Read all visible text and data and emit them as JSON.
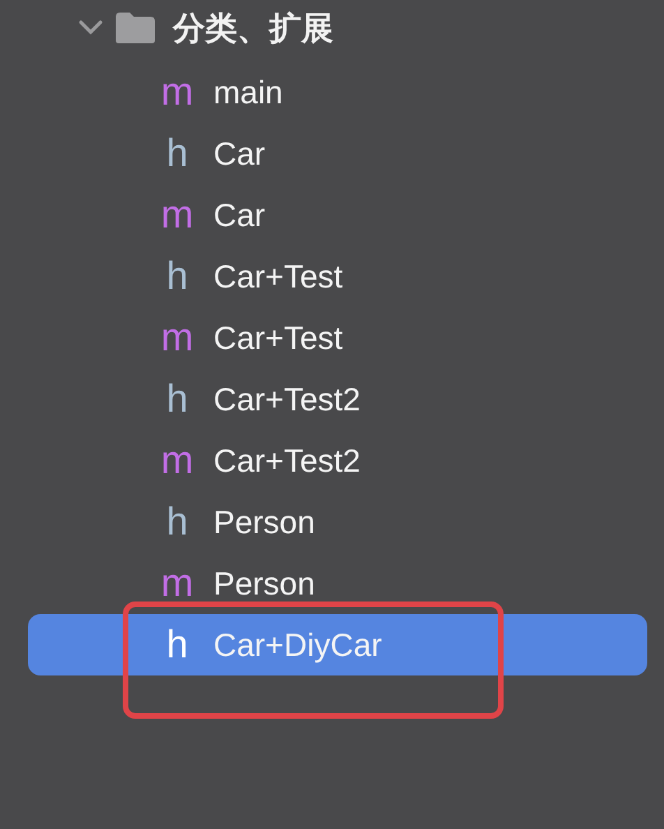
{
  "folder": {
    "name": "分类、扩展",
    "expanded": true
  },
  "files": [
    {
      "kind": "m",
      "glyph": "m",
      "name": "main",
      "selected": false
    },
    {
      "kind": "h",
      "glyph": "h",
      "name": "Car",
      "selected": false
    },
    {
      "kind": "m",
      "glyph": "m",
      "name": "Car",
      "selected": false
    },
    {
      "kind": "h",
      "glyph": "h",
      "name": "Car+Test",
      "selected": false
    },
    {
      "kind": "m",
      "glyph": "m",
      "name": "Car+Test",
      "selected": false
    },
    {
      "kind": "h",
      "glyph": "h",
      "name": "Car+Test2",
      "selected": false
    },
    {
      "kind": "m",
      "glyph": "m",
      "name": "Car+Test2",
      "selected": false
    },
    {
      "kind": "h",
      "glyph": "h",
      "name": "Person",
      "selected": false
    },
    {
      "kind": "m",
      "glyph": "m",
      "name": "Person",
      "selected": false
    },
    {
      "kind": "h",
      "glyph": "h",
      "name": "Car+DiyCar",
      "selected": true
    }
  ]
}
